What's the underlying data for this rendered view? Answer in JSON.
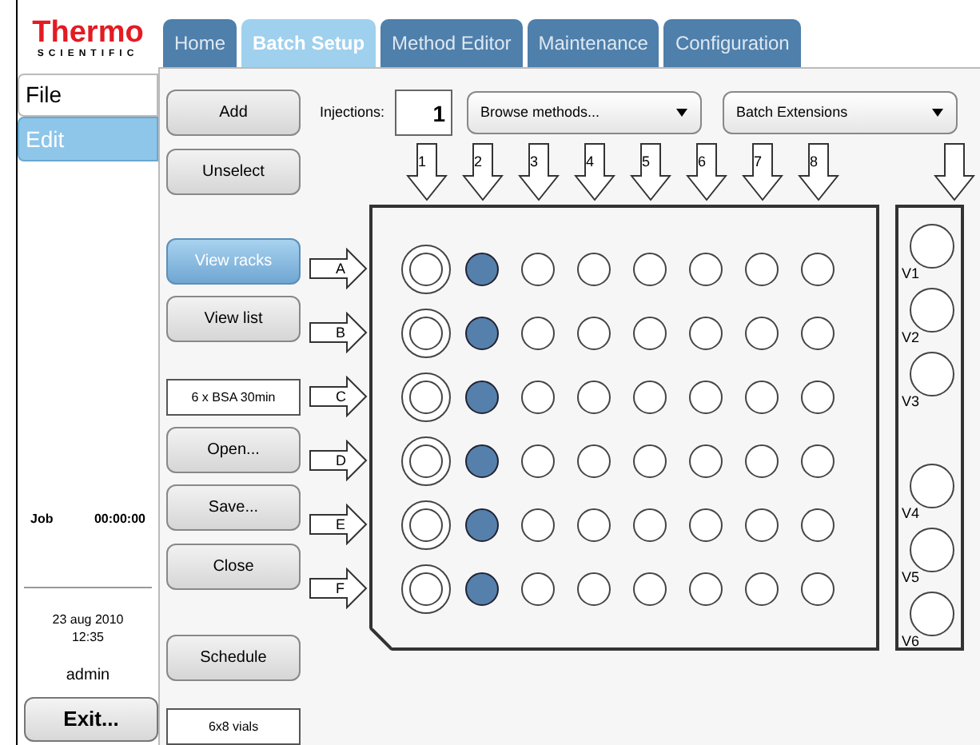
{
  "logo": {
    "name": "Thermo",
    "tagline": "SCIENTIFIC"
  },
  "tabs": [
    {
      "label": "Home",
      "selected": false
    },
    {
      "label": "Batch Setup",
      "selected": true
    },
    {
      "label": "Method Editor",
      "selected": false
    },
    {
      "label": "Maintenance",
      "selected": false
    },
    {
      "label": "Configuration",
      "selected": false
    }
  ],
  "side_menu": [
    {
      "label": "File",
      "selected": false
    },
    {
      "label": "Edit",
      "selected": true
    }
  ],
  "job": {
    "label": "Job",
    "time": "00:00:00"
  },
  "clock": {
    "date": "23 aug 2010",
    "time": "12:35"
  },
  "user": "admin",
  "exit_button": "Exit...",
  "actions": [
    {
      "kind": "button",
      "label": "Add",
      "selected": false
    },
    {
      "kind": "button",
      "label": "Unselect",
      "selected": false
    },
    {
      "kind": "button",
      "label": "View racks",
      "selected": true
    },
    {
      "kind": "button",
      "label": "View list",
      "selected": false
    },
    {
      "kind": "info",
      "label": "6 x BSA 30min"
    },
    {
      "kind": "button",
      "label": "Open...",
      "selected": false
    },
    {
      "kind": "button",
      "label": "Save...",
      "selected": false
    },
    {
      "kind": "button",
      "label": "Close",
      "selected": false
    },
    {
      "kind": "button",
      "label": "Schedule",
      "selected": false
    },
    {
      "kind": "info",
      "label": "6x8 vials"
    }
  ],
  "injections": {
    "label": "Injections:",
    "value": "1"
  },
  "dropdowns": [
    {
      "value": "Browse methods..."
    },
    {
      "value": "Batch Extensions"
    }
  ],
  "columns": [
    "1",
    "2",
    "3",
    "4",
    "5",
    "6",
    "7",
    "8"
  ],
  "rows": [
    {
      "label": "A",
      "wells": [
        {
          "kind": "double",
          "selected": false
        },
        {
          "kind": "single",
          "selected": true
        },
        {
          "kind": "single",
          "selected": false
        },
        {
          "kind": "single",
          "selected": false
        },
        {
          "kind": "single",
          "selected": false
        },
        {
          "kind": "single",
          "selected": false
        },
        {
          "kind": "single",
          "selected": false
        },
        {
          "kind": "single",
          "selected": false
        }
      ]
    },
    {
      "label": "B",
      "wells": [
        {
          "kind": "double",
          "selected": false
        },
        {
          "kind": "single",
          "selected": true
        },
        {
          "kind": "single",
          "selected": false
        },
        {
          "kind": "single",
          "selected": false
        },
        {
          "kind": "single",
          "selected": false
        },
        {
          "kind": "single",
          "selected": false
        },
        {
          "kind": "single",
          "selected": false
        },
        {
          "kind": "single",
          "selected": false
        }
      ]
    },
    {
      "label": "C",
      "wells": [
        {
          "kind": "double",
          "selected": false
        },
        {
          "kind": "single",
          "selected": true
        },
        {
          "kind": "single",
          "selected": false
        },
        {
          "kind": "single",
          "selected": false
        },
        {
          "kind": "single",
          "selected": false
        },
        {
          "kind": "single",
          "selected": false
        },
        {
          "kind": "single",
          "selected": false
        },
        {
          "kind": "single",
          "selected": false
        }
      ]
    },
    {
      "label": "D",
      "wells": [
        {
          "kind": "double",
          "selected": false
        },
        {
          "kind": "single",
          "selected": true
        },
        {
          "kind": "single",
          "selected": false
        },
        {
          "kind": "single",
          "selected": false
        },
        {
          "kind": "single",
          "selected": false
        },
        {
          "kind": "single",
          "selected": false
        },
        {
          "kind": "single",
          "selected": false
        },
        {
          "kind": "single",
          "selected": false
        }
      ]
    },
    {
      "label": "E",
      "wells": [
        {
          "kind": "double",
          "selected": false
        },
        {
          "kind": "single",
          "selected": true
        },
        {
          "kind": "single",
          "selected": false
        },
        {
          "kind": "single",
          "selected": false
        },
        {
          "kind": "single",
          "selected": false
        },
        {
          "kind": "single",
          "selected": false
        },
        {
          "kind": "single",
          "selected": false
        },
        {
          "kind": "single",
          "selected": false
        }
      ]
    },
    {
      "label": "F",
      "wells": [
        {
          "kind": "double",
          "selected": false
        },
        {
          "kind": "single",
          "selected": true
        },
        {
          "kind": "single",
          "selected": false
        },
        {
          "kind": "single",
          "selected": false
        },
        {
          "kind": "single",
          "selected": false
        },
        {
          "kind": "single",
          "selected": false
        },
        {
          "kind": "single",
          "selected": false
        },
        {
          "kind": "single",
          "selected": false
        }
      ]
    }
  ],
  "vial_groups": [
    [
      {
        "label": "V1"
      },
      {
        "label": "V2"
      },
      {
        "label": "V3"
      }
    ],
    [
      {
        "label": "V4"
      },
      {
        "label": "V5"
      },
      {
        "label": "V6"
      }
    ]
  ]
}
